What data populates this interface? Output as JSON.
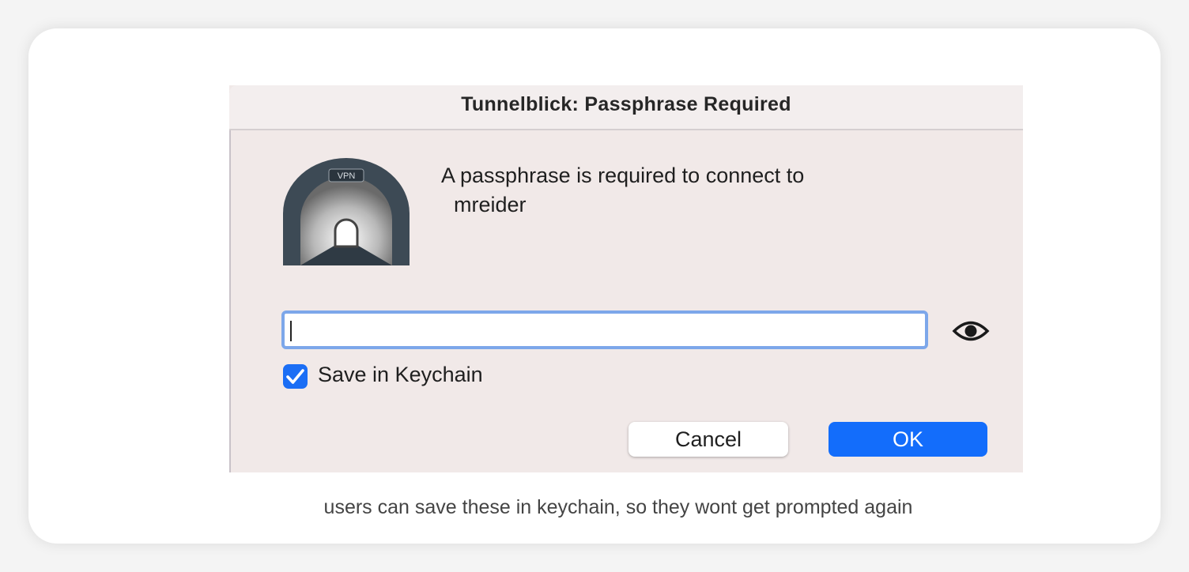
{
  "dialog": {
    "title": "Tunnelblick: Passphrase Required",
    "icon_label": "VPN",
    "message_line1": "A passphrase is required to connect to",
    "message_line2": "mreider",
    "passphrase_value": "",
    "save_in_keychain_label": "Save in Keychain",
    "save_in_keychain_checked": true,
    "cancel_label": "Cancel",
    "ok_label": "OK"
  },
  "caption": "users can save these in keychain, so they wont get prompted again",
  "colors": {
    "accent": "#136dfb",
    "focus_ring": "#7da7ea",
    "dialog_bg": "#f1e9e8"
  },
  "icons": {
    "app": "tunnelblick-tunnel-icon",
    "reveal": "eye-icon",
    "check": "checkmark-icon"
  }
}
